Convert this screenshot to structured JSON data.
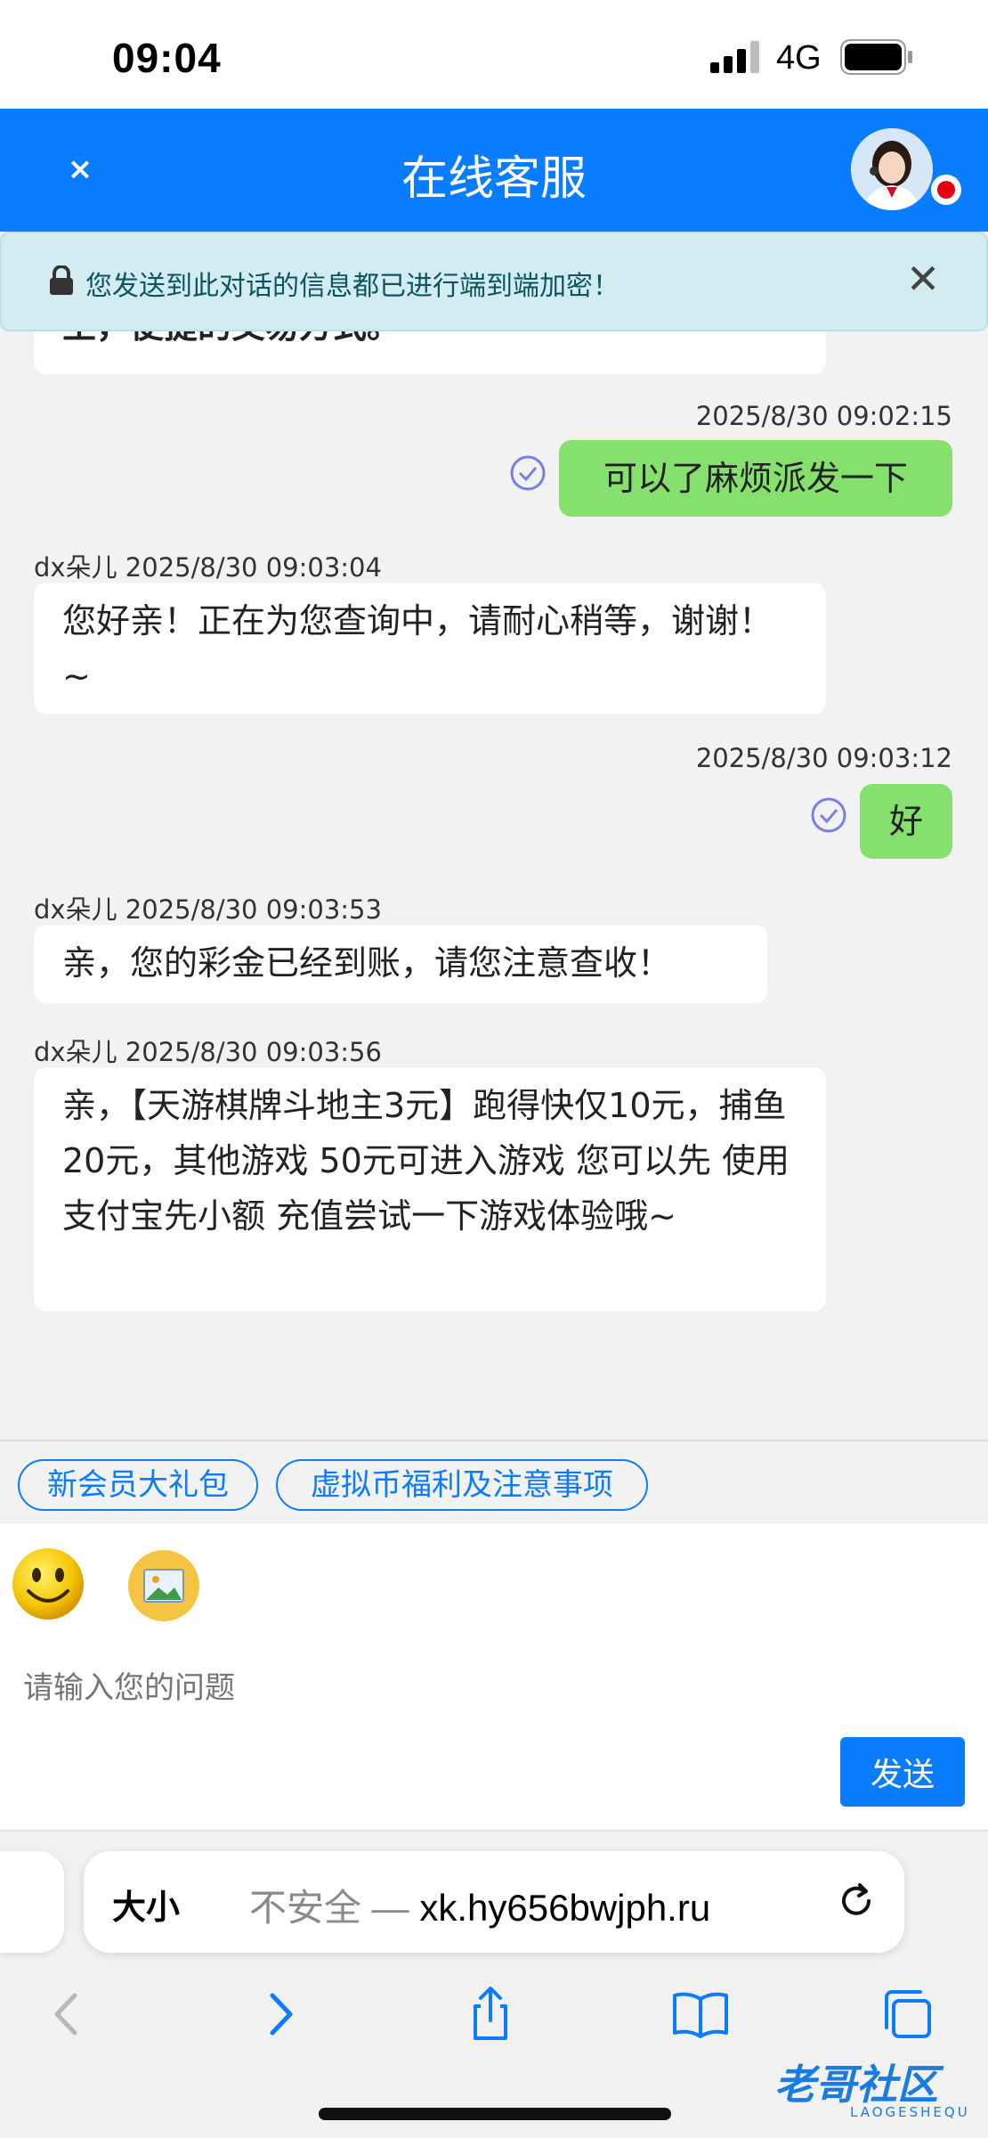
{
  "status_bar": {
    "time": "09:04",
    "network": "4G"
  },
  "header": {
    "close_label": "×",
    "title": "在线客服"
  },
  "notice": {
    "text": "您发送到此对话的信息都已进行端到端加密！",
    "close_label": "✕"
  },
  "messages": [
    {
      "side": "left",
      "text": "主，便捷的交易方式。"
    },
    {
      "side": "right",
      "meta": "2025/8/30 09:02:15",
      "text": "可以了麻烦派发一下"
    },
    {
      "side": "left",
      "meta": "dx朵儿 2025/8/30 09:03:04",
      "text": "您好亲！正在为您查询中，请耐心稍等，谢谢！~"
    },
    {
      "side": "right",
      "meta": "2025/8/30 09:03:12",
      "text": "好"
    },
    {
      "side": "left",
      "meta": "dx朵儿 2025/8/30 09:03:53",
      "text": "亲，您的彩金已经到账，请您注意查收！"
    },
    {
      "side": "left",
      "meta": "dx朵儿 2025/8/30 09:03:56",
      "text": "亲，【天游棋牌斗地主3元】跑得快仅10元，捕鱼20元，其他游戏 50元可进入游戏 您可以先 使用支付宝先小额 充值尝试一下游戏体验哦~"
    }
  ],
  "quick_tags": [
    "新会员大礼包",
    "虚拟币福利及注意事项"
  ],
  "input": {
    "placeholder": "请输入您的问题",
    "send_label": "发送"
  },
  "browser": {
    "text_size_label": "大小",
    "insecure_label": "不安全 — ",
    "url": "xk.hy656bwjph.ru"
  },
  "watermark": {
    "text": "老哥社区",
    "sub": "LAOGESHEQU"
  },
  "colors": {
    "primary": "#0a7cff",
    "sent_bubble": "#86e06e",
    "notice_bg": "#d3ecf1",
    "online_dot": "#e60012"
  }
}
